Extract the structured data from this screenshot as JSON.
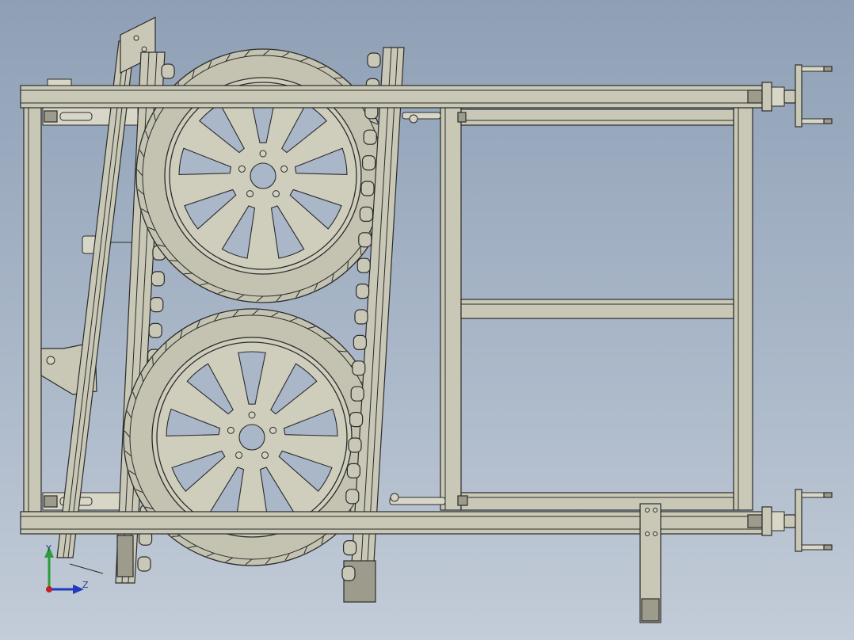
{
  "viewport": {
    "background_top": "#8fa0b6",
    "background_bottom": "#c3ccd8",
    "part_color": "#c9c8b6",
    "edge_color": "#2b2b2b"
  },
  "triad": {
    "y_label": "Y",
    "z_label": "Z",
    "y_color": "#2e9c3a",
    "z_color": "#1f3bbd",
    "origin_color": "#c0202a"
  }
}
